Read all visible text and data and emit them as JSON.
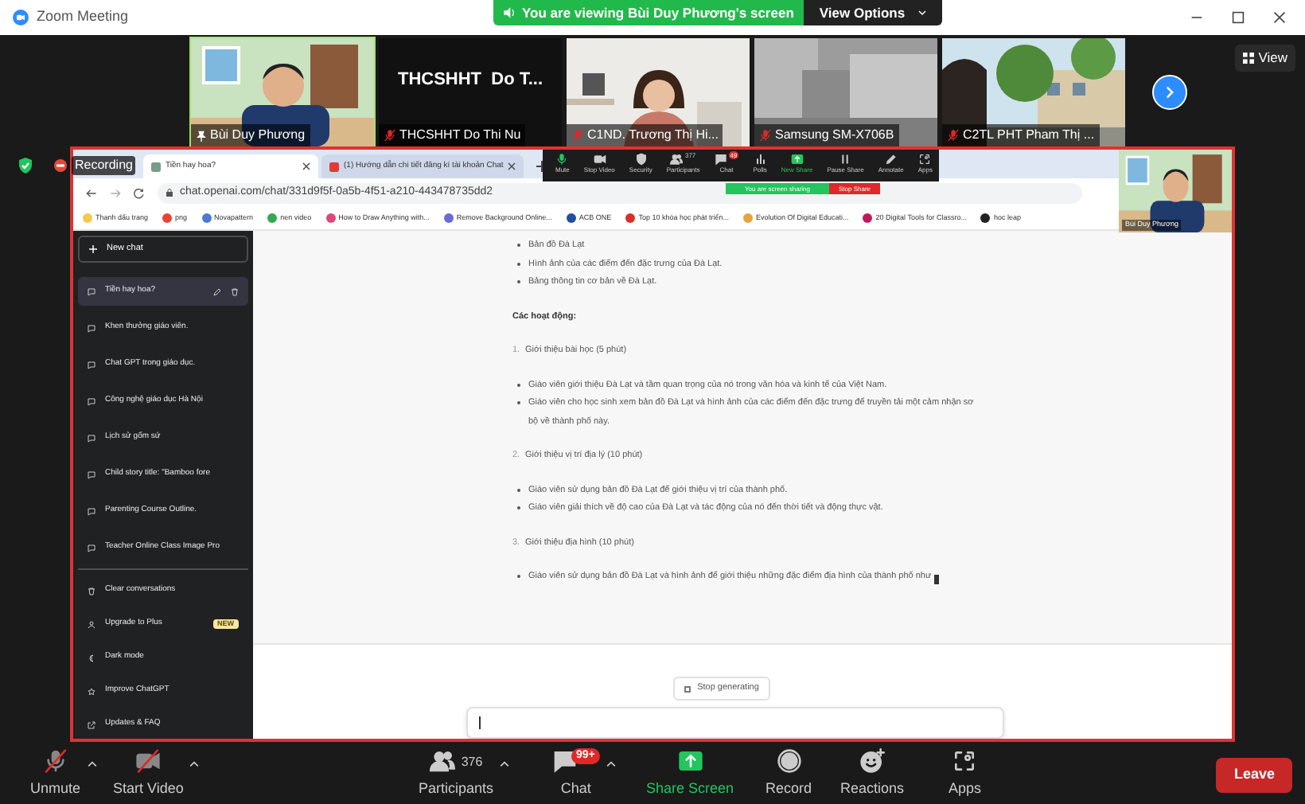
{
  "window": {
    "title": "Zoom Meeting"
  },
  "share_banner": {
    "text": "You are viewing Bùi Duy Phương's screen",
    "button": "View Options"
  },
  "gallery": {
    "tiles": [
      {
        "name": "Bùi Duy Phương",
        "pinned": true,
        "muted": false,
        "kind": "picture"
      },
      {
        "name": "THCSHHT Do Thi Nu",
        "pinned": false,
        "muted": true,
        "kind": "text",
        "display": "THCSHHT  Do T..."
      },
      {
        "name": "C1ND. Trương Thị Hi...",
        "pinned": false,
        "muted": true,
        "kind": "picture"
      },
      {
        "name": "Samsung SM-X706B",
        "pinned": false,
        "muted": true,
        "kind": "picture"
      },
      {
        "name": "C2TL PHT Pham Thị ...",
        "pinned": false,
        "muted": true,
        "kind": "picture"
      }
    ],
    "view_button": "View"
  },
  "recording": "Recording",
  "shared_screen": {
    "browser": {
      "tabs": [
        {
          "title": "Tiền hay hoa?",
          "selected": true
        },
        {
          "title": "(1) Hướng dẫn chi tiết đăng kí tài khoản Chat",
          "selected": false
        }
      ],
      "url": "chat.openai.com/chat/331d9f5f-0a5b-4f51-a210-443478735dd2",
      "bookmarks": [
        {
          "label": "Thanh dấu trang",
          "color": "#f2c94c"
        },
        {
          "label": "png",
          "color": "#ea4335"
        },
        {
          "label": "Novapattern",
          "color": "#4a7bd0"
        },
        {
          "label": "nen video",
          "color": "#34a853"
        },
        {
          "label": "How to Draw Anything with...",
          "color": "#e0457b"
        },
        {
          "label": "Remove Background Online...",
          "color": "#6b6bd6"
        },
        {
          "label": "ACB ONE",
          "color": "#1f4fa0"
        },
        {
          "label": "Top 10 khóa học phát triển...",
          "color": "#d93025"
        },
        {
          "label": "Evolution Of Digital Educati...",
          "color": "#e8a33d"
        },
        {
          "label": "20 Digital Tools for Classro...",
          "color": "#c2185b"
        },
        {
          "label": "hoc leap",
          "color": "#222222"
        }
      ]
    },
    "meeting_toolbar": {
      "items": [
        {
          "label": "Mute",
          "kind": "mic"
        },
        {
          "label": "Stop Video",
          "kind": "video"
        },
        {
          "label": "Security",
          "kind": "shield"
        },
        {
          "label": "Participants",
          "kind": "people",
          "count": "377"
        },
        {
          "label": "Chat",
          "kind": "chat",
          "badge": "49"
        },
        {
          "label": "Polls",
          "kind": "polls"
        },
        {
          "label": "New Share",
          "kind": "share"
        },
        {
          "label": "Pause Share",
          "kind": "pause"
        },
        {
          "label": "Annotate",
          "kind": "pen"
        },
        {
          "label": "Apps",
          "kind": "apps"
        }
      ],
      "sharing_notice": "You are screen sharing",
      "stop_share": "Stop Share"
    },
    "self_view": {
      "name": "Bùi Duy Phương"
    },
    "sidebar": {
      "new_chat": "New chat",
      "conversations": [
        {
          "title": "Tiền hay hoa?",
          "selected": true
        },
        {
          "title": "Khen thưởng giáo viên.",
          "selected": false
        },
        {
          "title": "Chat GPT trong giáo dục.",
          "selected": false
        },
        {
          "title": "Công nghệ giáo dục Hà Nội",
          "selected": false
        },
        {
          "title": "Lịch sử gốm sứ",
          "selected": false
        },
        {
          "title": "Child story title: \"Bamboo fore",
          "selected": false
        },
        {
          "title": "Parenting Course Outline.",
          "selected": false
        },
        {
          "title": "Teacher Online Class Image Pro",
          "selected": false
        }
      ],
      "menu": [
        {
          "label": "Clear conversations",
          "kind": "trash"
        },
        {
          "label": "Upgrade to Plus",
          "kind": "user",
          "badge": "NEW"
        },
        {
          "label": "Dark mode",
          "kind": "moon"
        },
        {
          "label": "Improve ChatGPT",
          "kind": "star"
        },
        {
          "label": "Updates & FAQ",
          "kind": "link"
        }
      ]
    },
    "content": [
      {
        "kind": "bullet",
        "text": "Bản đồ Đà Lạt"
      },
      {
        "kind": "bullet",
        "text": "Hình ảnh của các điểm đến đặc trưng của Đà Lạt."
      },
      {
        "kind": "bullet",
        "text": "Bảng thông tin cơ bản về Đà Lạt."
      },
      {
        "kind": "heading",
        "text": "Các hoạt động:"
      },
      {
        "kind": "numbered",
        "number": "1.",
        "text": "Giới thiệu bài học (5 phút)"
      },
      {
        "kind": "bullet",
        "text": "Giáo viên giới thiệu Đà Lạt và tầm quan trọng của nó trong văn hóa và kinh tế của Việt Nam."
      },
      {
        "kind": "bullet",
        "text": "Giáo viên cho học sinh xem bản đồ Đà Lạt và hình ảnh của các điểm đến đặc trưng để truyền tải một cảm nhận sơ bộ về thành phố này."
      },
      {
        "kind": "numbered",
        "number": "2.",
        "text": "Giới thiệu vị trí địa lý (10 phút)"
      },
      {
        "kind": "bullet",
        "text": "Giáo viên sử dụng bản đồ Đà Lạt để giới thiệu vị trí của thành phố."
      },
      {
        "kind": "bullet",
        "text": "Giáo viên giải thích về độ cao của Đà Lạt và tác động của nó đến thời tiết và động thực vật."
      },
      {
        "kind": "numbered",
        "number": "3.",
        "text": "Giới thiệu địa hình (10 phút)"
      },
      {
        "kind": "bullet",
        "text": "Giáo viên sử dụng bản đồ Đà Lạt và hình ảnh để giới thiệu những đặc điểm địa hình của thành phố như",
        "cursor": true
      }
    ],
    "stop_button": "Stop generating"
  },
  "toolbar": {
    "items": [
      {
        "label": "Unmute",
        "kind": "mic",
        "off": true,
        "caret": true
      },
      {
        "label": "Start Video",
        "kind": "video",
        "off": true,
        "caret": true
      },
      {
        "label": "Participants",
        "kind": "people",
        "count": "376",
        "caret": true
      },
      {
        "label": "Chat",
        "kind": "chat",
        "badge": "99+",
        "caret": true
      },
      {
        "label": "Share Screen",
        "kind": "share"
      },
      {
        "label": "Record",
        "kind": "record"
      },
      {
        "label": "Reactions",
        "kind": "smile"
      },
      {
        "label": "Apps",
        "kind": "apps"
      }
    ],
    "leave": "Leave"
  }
}
